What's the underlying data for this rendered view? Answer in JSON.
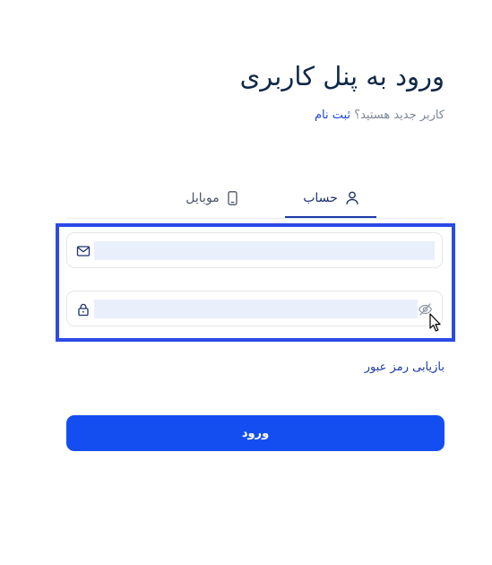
{
  "header": {
    "title": "ورود به پنل کاربری",
    "subtitle_prefix": "کاربر جدید هستید؟",
    "register_link": "ثبت نام"
  },
  "tabs": [
    {
      "label": "حساب",
      "icon": "user-icon",
      "active": true
    },
    {
      "label": "موبایل",
      "icon": "mobile-icon",
      "active": false
    }
  ],
  "form": {
    "email": {
      "icon": "mail-icon",
      "value": "",
      "placeholder": ""
    },
    "password": {
      "icon": "lock-icon",
      "value": "",
      "placeholder": "",
      "toggle_icon": "eye-off-icon"
    },
    "forgot_link": "بازیابی رمز عبور",
    "submit_label": "ورود"
  },
  "colors": {
    "primary": "#154ef0",
    "title": "#0f2847",
    "highlight": "#2b4ae6",
    "input_fill": "#e9effb"
  }
}
